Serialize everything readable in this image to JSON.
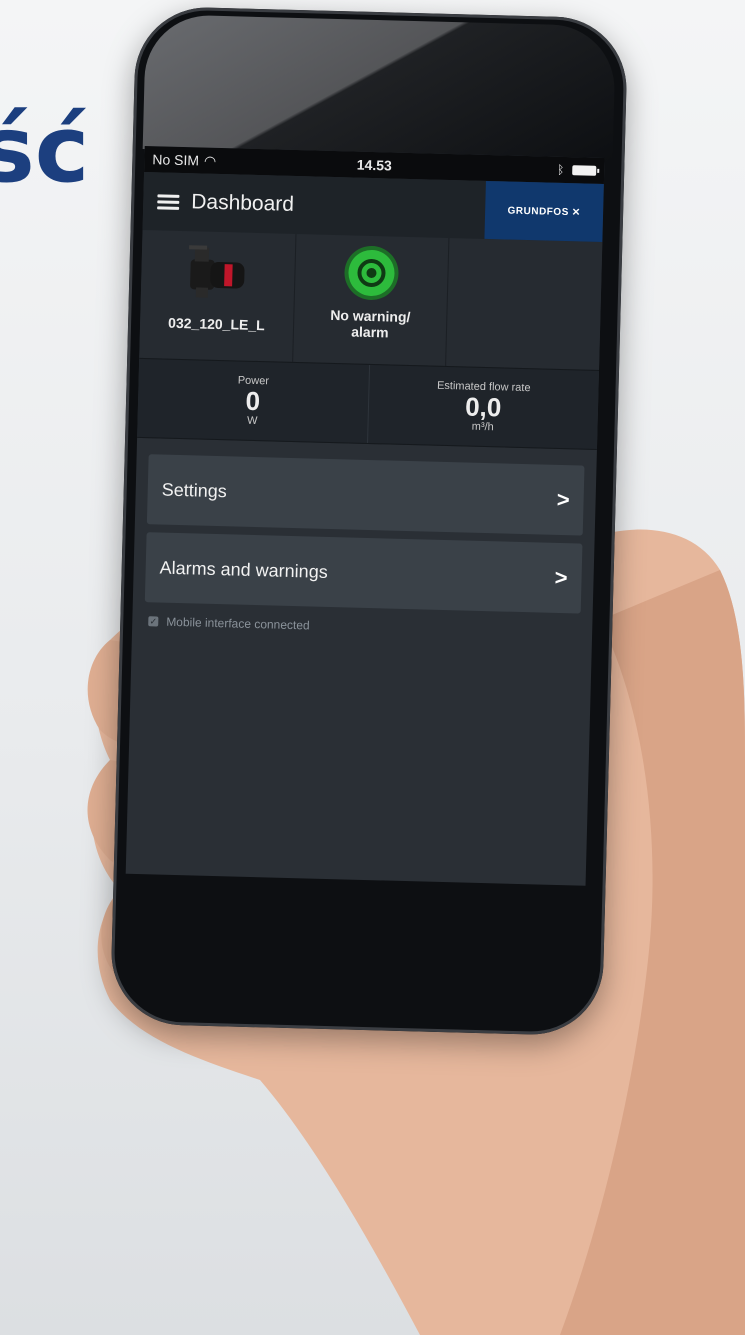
{
  "background_text": "ść",
  "status_bar": {
    "carrier": "No SIM",
    "time": "14.53"
  },
  "app_bar": {
    "title": "Dashboard",
    "logo": "GRUNDFOS"
  },
  "tiles": [
    {
      "label": "032_120_LE_L",
      "icon": "pump-icon"
    },
    {
      "label": "No warning/ alarm",
      "icon": "status-ok-icon"
    }
  ],
  "readings": [
    {
      "label": "Power",
      "value": "0",
      "unit": "W"
    },
    {
      "label": "Estimated flow rate",
      "value": "0,0",
      "unit": "m³/h"
    }
  ],
  "menu": [
    {
      "label": "Settings"
    },
    {
      "label": "Alarms and warnings"
    }
  ],
  "connection": {
    "label": "Mobile interface connected",
    "checked": true
  },
  "colors": {
    "brand_blue": "#10386d",
    "status_green": "#2dbb3c",
    "screen_bg": "#2a2f35"
  }
}
